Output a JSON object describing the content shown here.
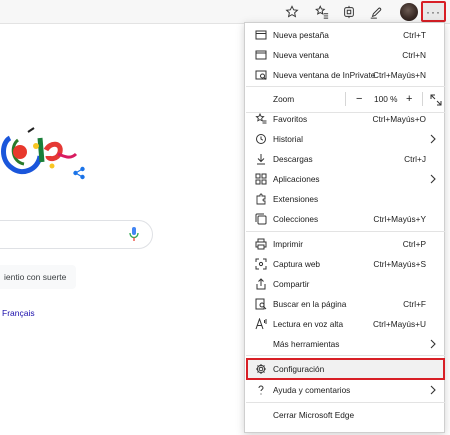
{
  "toolbar": {
    "icons": [
      "star-add-icon",
      "favorites-icon",
      "collections-icon",
      "feedback-icon",
      "profile-avatar",
      "more-options-icon"
    ],
    "more_label": "···"
  },
  "page": {
    "lucky_button": "ientio con suerte",
    "language_link": "Français"
  },
  "menu": {
    "items": [
      {
        "label": "Nueva pestaña",
        "shortcut": "Ctrl+T",
        "icon": "new-tab-icon"
      },
      {
        "label": "Nueva ventana",
        "shortcut": "Ctrl+N",
        "icon": "new-window-icon"
      },
      {
        "label": "Nueva ventana de InPrivate",
        "shortcut": "Ctrl+Mayús+N",
        "icon": "inprivate-icon"
      },
      {
        "label": "Favoritos",
        "shortcut": "Ctrl+Mayús+O",
        "icon": "favorites-icon"
      },
      {
        "label": "Historial",
        "shortcut": "",
        "icon": "history-icon",
        "submenu": true
      },
      {
        "label": "Descargas",
        "shortcut": "Ctrl+J",
        "icon": "download-icon"
      },
      {
        "label": "Aplicaciones",
        "shortcut": "",
        "icon": "apps-icon",
        "submenu": true
      },
      {
        "label": "Extensiones",
        "shortcut": "",
        "icon": "extensions-icon"
      },
      {
        "label": "Colecciones",
        "shortcut": "Ctrl+Mayús+Y",
        "icon": "collections-icon"
      },
      {
        "label": "Imprimir",
        "shortcut": "Ctrl+P",
        "icon": "print-icon"
      },
      {
        "label": "Captura web",
        "shortcut": "Ctrl+Mayús+S",
        "icon": "web-capture-icon"
      },
      {
        "label": "Compartir",
        "shortcut": "",
        "icon": "share-icon"
      },
      {
        "label": "Buscar en la página",
        "shortcut": "Ctrl+F",
        "icon": "find-icon"
      },
      {
        "label": "Lectura en voz alta",
        "shortcut": "Ctrl+Mayús+U",
        "icon": "read-aloud-icon"
      },
      {
        "label": "Más herramientas",
        "shortcut": "",
        "icon": "",
        "submenu": true
      },
      {
        "label": "Configuración",
        "shortcut": "",
        "icon": "gear-icon",
        "highlighted": true
      },
      {
        "label": "Ayuda y comentarios",
        "shortcut": "",
        "icon": "help-icon",
        "submenu": true
      },
      {
        "label": "Cerrar Microsoft Edge",
        "shortcut": "",
        "icon": ""
      }
    ],
    "zoom": {
      "label": "Zoom",
      "minus": "−",
      "value": "100 %",
      "plus": "+"
    }
  },
  "colors": {
    "highlight_border": "#d81f26",
    "link": "#1a0dab"
  }
}
